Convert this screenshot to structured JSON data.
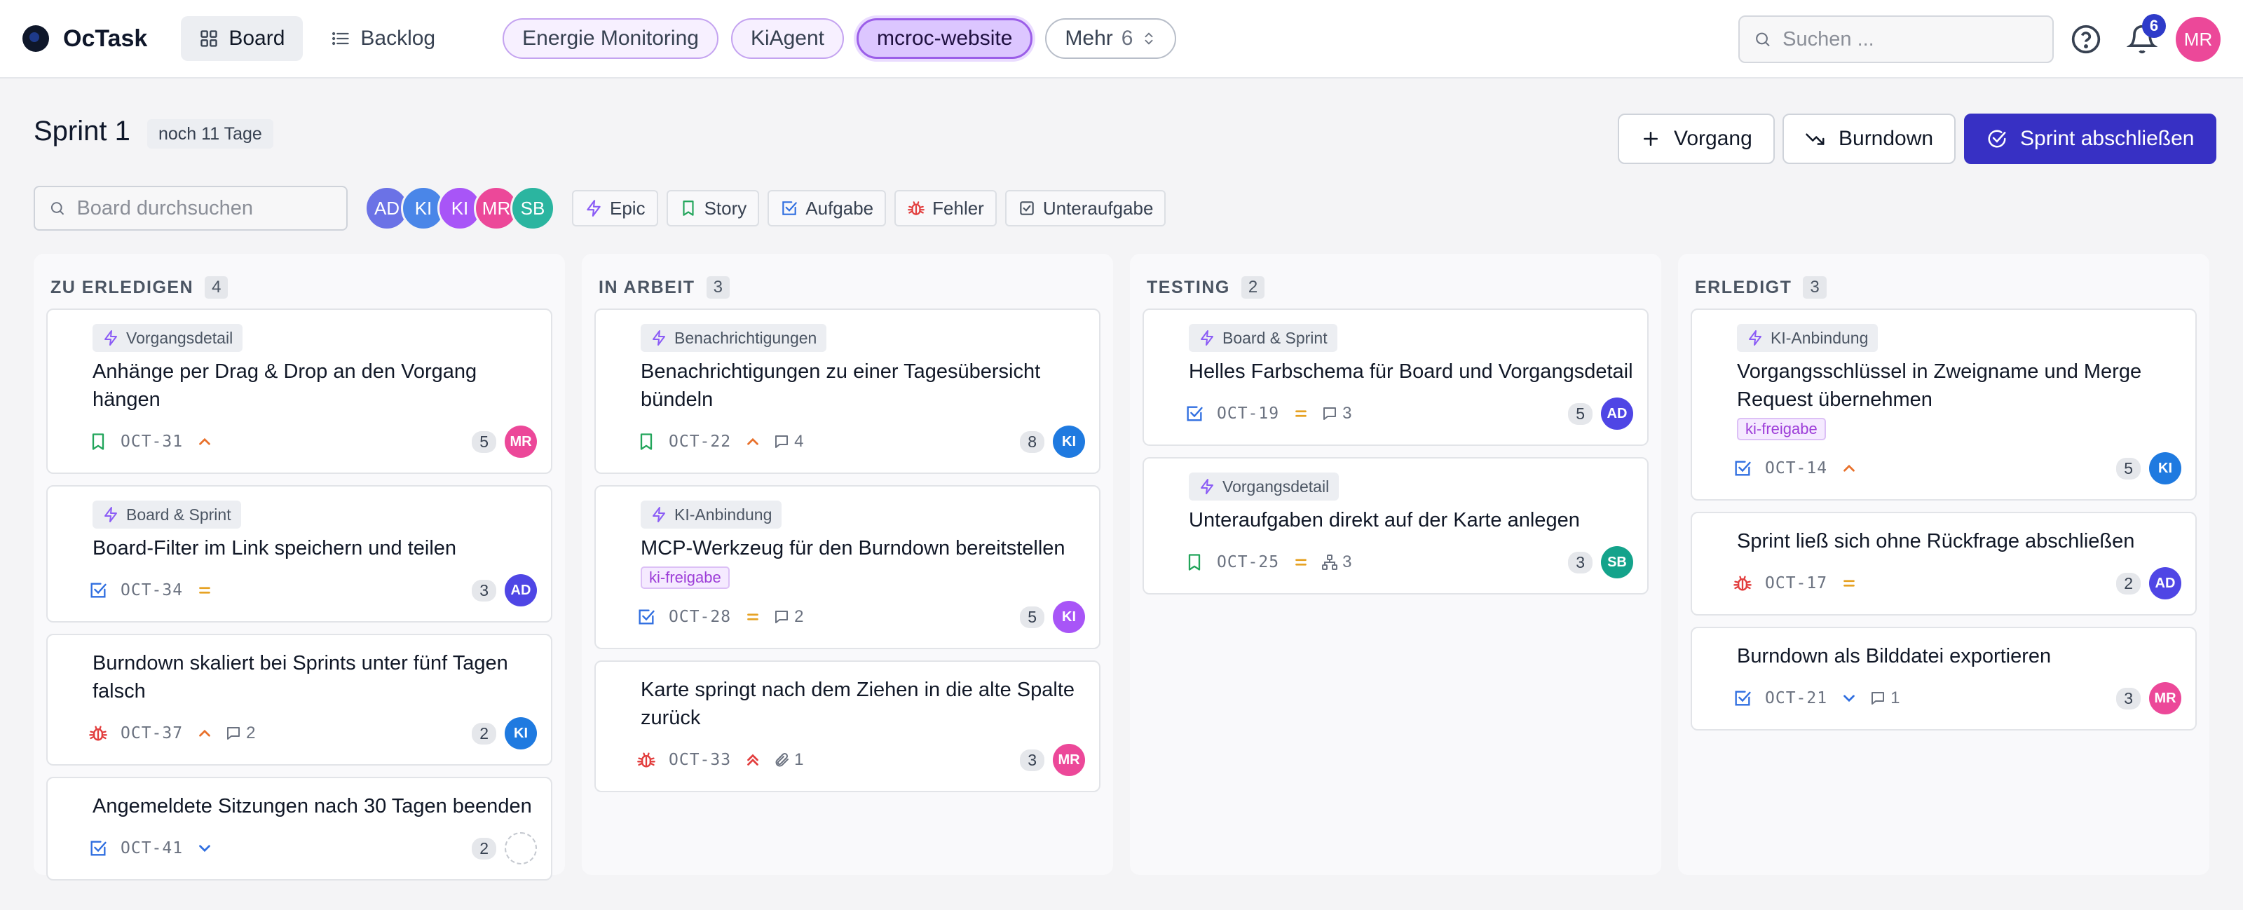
{
  "app": {
    "name": "OcTask"
  },
  "nav": {
    "board": "Board",
    "backlog": "Backlog"
  },
  "projects": [
    {
      "label": "Energie Monitoring",
      "active": false
    },
    {
      "label": "KiAgent",
      "active": false
    },
    {
      "label": "mcroc-website",
      "active": true
    }
  ],
  "more": {
    "label": "Mehr",
    "count": "6"
  },
  "search": {
    "placeholder": "Suchen ..."
  },
  "notifications": {
    "count": "6"
  },
  "user": {
    "initials": "MR"
  },
  "sprint": {
    "title": "Sprint 1",
    "remaining": "noch 11 Tage"
  },
  "actions": {
    "add_issue": "Vorgang",
    "burndown": "Burndown",
    "complete_sprint": "Sprint abschließen"
  },
  "board_search": {
    "placeholder": "Board durchsuchen"
  },
  "members": [
    {
      "initials": "AD",
      "color": "#6b72e6"
    },
    {
      "initials": "KI",
      "color": "#4a86e8"
    },
    {
      "initials": "KI",
      "color": "#a855f7"
    },
    {
      "initials": "MR",
      "color": "#ec4899"
    },
    {
      "initials": "SB",
      "color": "#2bb5a0"
    }
  ],
  "type_filters": {
    "epic": "Epic",
    "story": "Story",
    "task": "Aufgabe",
    "bug": "Fehler",
    "subtask": "Unteraufgabe"
  },
  "colors": {
    "accent": "#3730c4",
    "epic": "#8b5cf6",
    "story": "#22a55b",
    "task": "#2f6ee0",
    "bug": "#e23d3d",
    "prio_high": "#e8702a",
    "prio_medium": "#e6a224",
    "prio_low": "#2f6ee0"
  },
  "columns": [
    {
      "title": "ZU ERLEDIGEN",
      "count": "4",
      "cards": [
        {
          "epic": "Vorgangsdetail",
          "title": "Anhänge per Drag & Drop an den Vorgang hängen",
          "type": "story",
          "key": "OCT-31",
          "priority": "high",
          "points": "5",
          "assignee": "MR",
          "assignee_color": "#ec4899"
        },
        {
          "epic": "Board & Sprint",
          "title": "Board-Filter im Link speichern und teilen",
          "type": "task",
          "key": "OCT-34",
          "priority": "medium",
          "points": "3",
          "assignee": "AD",
          "assignee_color": "#4f46e5"
        },
        {
          "title": "Burndown skaliert bei Sprints unter fünf Tagen falsch",
          "type": "bug",
          "key": "OCT-37",
          "priority": "high",
          "comments": "2",
          "points": "2",
          "assignee": "KI",
          "assignee_color": "#1f7ae0"
        },
        {
          "title": "Angemeldete Sitzungen nach 30 Tagen beenden",
          "type": "task",
          "key": "OCT-41",
          "priority": "low",
          "points": "2"
        }
      ]
    },
    {
      "title": "IN ARBEIT",
      "count": "3",
      "cards": [
        {
          "epic": "Benachrichtigungen",
          "title": "Benachrichtigungen zu einer Tagesübersicht bündeln",
          "type": "story",
          "key": "OCT-22",
          "priority": "high",
          "comments": "4",
          "points": "8",
          "assignee": "KI",
          "assignee_color": "#1f7ae0"
        },
        {
          "epic": "KI-Anbindung",
          "title": "MCP-Werkzeug für den Burndown bereitstellen",
          "label": "ki-freigabe",
          "type": "task",
          "key": "OCT-28",
          "priority": "medium",
          "comments": "2",
          "points": "5",
          "assignee": "KI",
          "assignee_color": "#a855f7"
        },
        {
          "title": "Karte springt nach dem Ziehen in die alte Spalte zurück",
          "type": "bug",
          "key": "OCT-33",
          "priority": "highest",
          "attachments": "1",
          "points": "3",
          "assignee": "MR",
          "assignee_color": "#ec4899"
        }
      ]
    },
    {
      "title": "TESTING",
      "count": "2",
      "cards": [
        {
          "epic": "Board & Sprint",
          "title": "Helles Farbschema für Board und Vorgangsdetail",
          "type": "task",
          "key": "OCT-19",
          "priority": "medium",
          "comments": "3",
          "points": "5",
          "assignee": "AD",
          "assignee_color": "#4f46e5"
        },
        {
          "epic": "Vorgangsdetail",
          "title": "Unteraufgaben direkt auf der Karte anlegen",
          "type": "story",
          "key": "OCT-25",
          "priority": "medium",
          "subtasks": "3",
          "points": "3",
          "assignee": "SB",
          "assignee_color": "#14a38b"
        }
      ]
    },
    {
      "title": "ERLEDIGT",
      "count": "3",
      "cards": [
        {
          "epic": "KI-Anbindung",
          "title": "Vorgangsschlüssel in Zweigname und Merge Request übernehmen",
          "label": "ki-freigabe",
          "type": "task",
          "key": "OCT-14",
          "priority": "high",
          "points": "5",
          "assignee": "KI",
          "assignee_color": "#1f7ae0"
        },
        {
          "title": "Sprint ließ sich ohne Rückfrage abschließen",
          "type": "bug",
          "key": "OCT-17",
          "priority": "medium",
          "points": "2",
          "assignee": "AD",
          "assignee_color": "#4f46e5"
        },
        {
          "title": "Burndown als Bilddatei exportieren",
          "type": "task",
          "key": "OCT-21",
          "priority": "low",
          "comments": "1",
          "points": "3",
          "assignee": "MR",
          "assignee_color": "#ec4899"
        }
      ]
    }
  ]
}
